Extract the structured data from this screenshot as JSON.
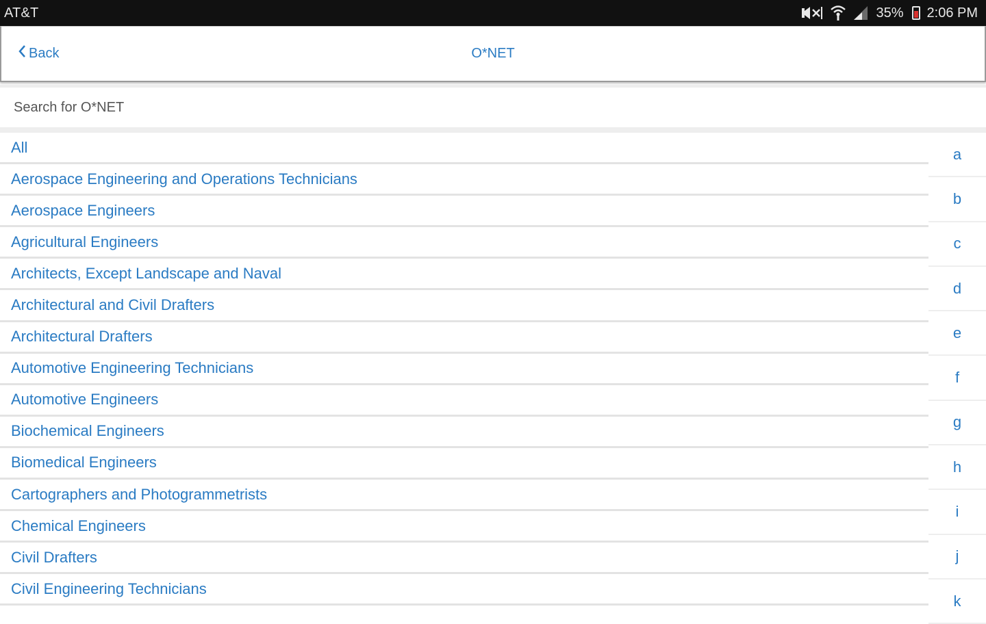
{
  "status_bar": {
    "carrier": "AT&T",
    "battery": "35%",
    "time": "2:06 PM",
    "icons": [
      "mute-icon",
      "wifi-icon",
      "signal-icon",
      "battery-icon"
    ]
  },
  "header": {
    "back_label": "Back",
    "title": "O*NET"
  },
  "search": {
    "placeholder": "Search for O*NET"
  },
  "list": [
    "All",
    "Aerospace Engineering and Operations Technicians",
    "Aerospace Engineers",
    "Agricultural Engineers",
    "Architects, Except Landscape and Naval",
    "Architectural and Civil Drafters",
    "Architectural Drafters",
    "Automotive Engineering Technicians",
    "Automotive Engineers",
    "Biochemical Engineers",
    "Biomedical Engineers",
    "Cartographers and Photogrammetrists",
    "Chemical Engineers",
    "Civil Drafters",
    "Civil Engineering Technicians"
  ],
  "alpha_index": [
    "a",
    "b",
    "c",
    "d",
    "e",
    "f",
    "g",
    "h",
    "i",
    "j",
    "k"
  ],
  "colors": {
    "accent": "#2a7bc3",
    "status_bg": "#111111",
    "divider": "#e3e3e3"
  }
}
